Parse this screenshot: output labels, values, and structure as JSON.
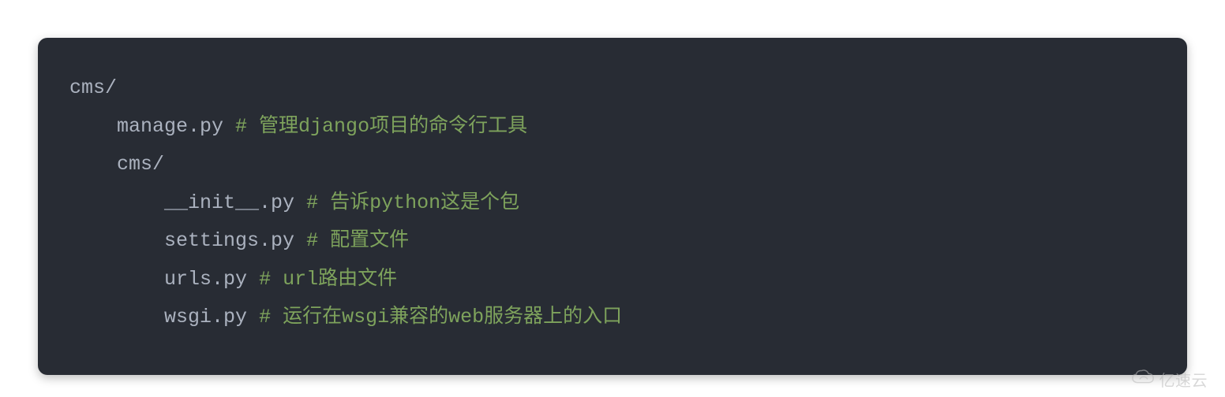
{
  "code": {
    "lines": [
      {
        "indent": "",
        "text": "cms/",
        "comment": ""
      },
      {
        "indent": "    ",
        "text": "manage.py ",
        "comment": "# 管理django项目的命令行工具"
      },
      {
        "indent": "    ",
        "text": "cms/",
        "comment": ""
      },
      {
        "indent": "        ",
        "text": "__init__.py ",
        "comment": "# 告诉python这是个包"
      },
      {
        "indent": "        ",
        "text": "settings.py ",
        "comment": "# 配置文件"
      },
      {
        "indent": "        ",
        "text": "urls.py ",
        "comment": "# url路由文件"
      },
      {
        "indent": "        ",
        "text": "wsgi.py ",
        "comment": "# 运行在wsgi兼容的web服务器上的入口"
      }
    ]
  },
  "watermark": {
    "text": "亿速云"
  }
}
